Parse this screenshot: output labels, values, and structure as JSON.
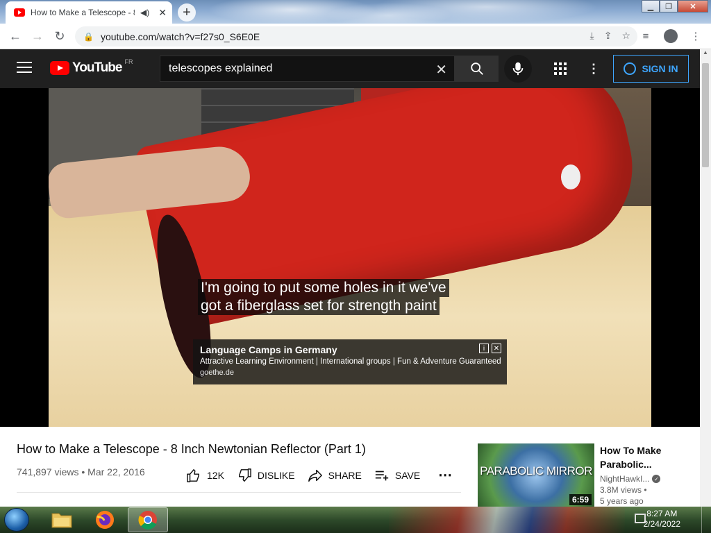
{
  "browser": {
    "tab_title": "How to Make a Telescope - 8 Inch Newtonian Reflector (Part 1)",
    "url": "youtube.com/watch?v=f27s0_S6E0E"
  },
  "youtube": {
    "logo_text": "YouTube",
    "country_code": "FR",
    "search_value": "telescopes explained",
    "sign_in_label": "SIGN IN"
  },
  "video": {
    "caption_line1": "I'm going to put some holes in it we've",
    "caption_line2": "got a fiberglass set for strength paint",
    "ad": {
      "headline": "Language Camps in Germany",
      "description": "Attractive Learning Environment | International groups | Fun & Adventure Guaranteed",
      "source": "goethe.de"
    }
  },
  "info": {
    "title": "How to Make a Telescope - 8 Inch Newtonian Reflector (Part 1)",
    "views_date": "741,897 views • Mar 22, 2016",
    "like_count": "12K",
    "dislike_label": "DISLIKE",
    "share_label": "SHARE",
    "save_label": "SAVE"
  },
  "recommendation": {
    "thumb_text": "PARABOLIC MIRROR",
    "duration": "6:59",
    "title": "How To Make Parabolic...",
    "channel": "NightHawkI...",
    "views": "3.8M views •",
    "age": "5 years ago"
  },
  "taskbar": {
    "time": "8:27 AM",
    "date": "2/24/2022"
  }
}
